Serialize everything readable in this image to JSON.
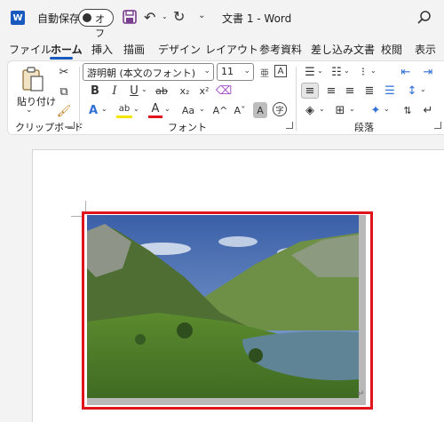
{
  "titlebar": {
    "app_icon": "W",
    "autosave_label": "自動保存",
    "autosave_state": "オフ",
    "doc_title": "文書 1  -  Word"
  },
  "tabs": [
    "ファイル",
    "ホーム",
    "挿入",
    "描画",
    "デザイン",
    "レイアウト",
    "参考資料",
    "差し込み文書",
    "校閲",
    "表示"
  ],
  "active_tab": "ホーム",
  "ribbon": {
    "clipboard": {
      "label": "クリップボード",
      "paste_label": "貼り付け"
    },
    "font": {
      "label": "フォント",
      "font_name": "游明朝 (本文のフォント)",
      "font_size": "11",
      "bold": "B",
      "italic": "I",
      "underline": "U",
      "strike": "ab",
      "subscript": "x₂",
      "superscript": "x²",
      "text_effects": "A",
      "highlight": "ab",
      "font_color": "A",
      "change_case": "Aa",
      "grow": "A^",
      "shrink": "Aˇ",
      "char_shade": "A",
      "enclose": "字"
    },
    "paragraph": {
      "label": "段落"
    }
  },
  "document": {
    "image_border_color": "#e0141c",
    "return_mark": "↵"
  }
}
